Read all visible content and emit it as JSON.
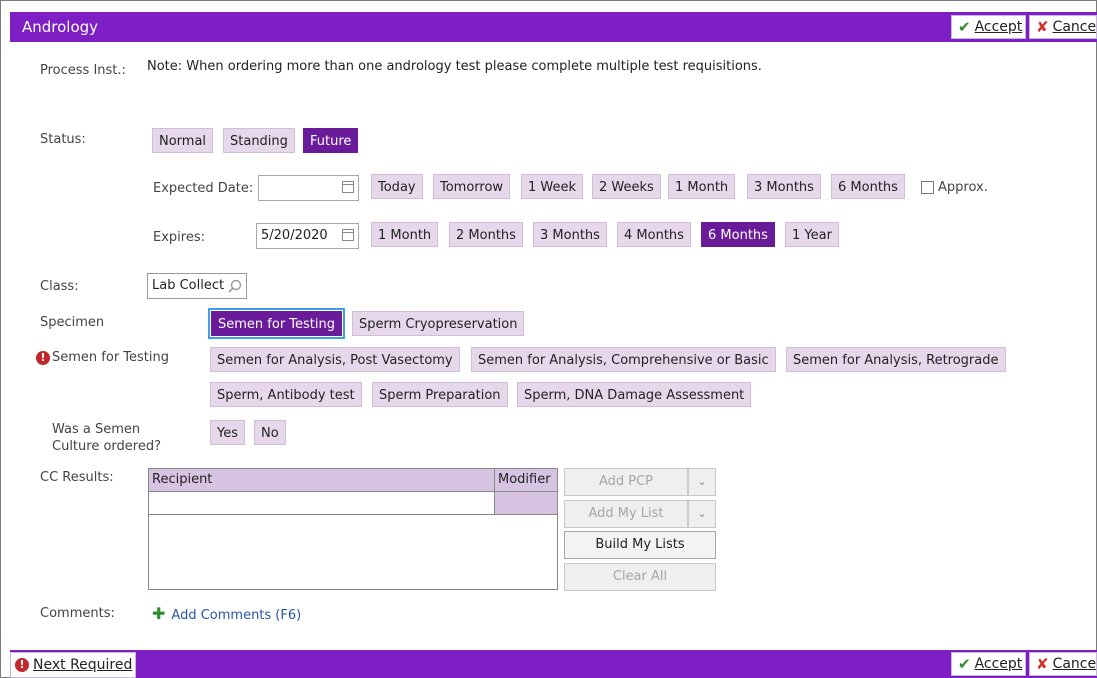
{
  "header": {
    "title": "Andrology",
    "accept": "Accept",
    "cancel": "Cancel"
  },
  "labels": {
    "process_inst": "Process Inst.:",
    "status": "Status:",
    "expected_date": "Expected Date:",
    "expires": "Expires:",
    "class": "Class:",
    "specimen": "Specimen",
    "semen_for_testing": "Semen for Testing",
    "culture_q": "Was a Semen Culture ordered?",
    "cc_results": "CC Results:",
    "comments": "Comments:"
  },
  "note": "Note: When ordering more than one andrology test please complete multiple test requisitions.",
  "status": {
    "options": [
      "Normal",
      "Standing",
      "Future"
    ],
    "selected": "Future"
  },
  "expected_date": {
    "value": "",
    "quick": [
      "Today",
      "Tomorrow",
      "1 Week",
      "2 Weeks",
      "1 Month",
      "3 Months",
      "6 Months"
    ],
    "approx": "Approx."
  },
  "expires": {
    "value": "5/20/2020",
    "options": [
      "1 Month",
      "2 Months",
      "3 Months",
      "4 Months",
      "6 Months",
      "1 Year"
    ],
    "selected": "6 Months"
  },
  "class": {
    "value": "Lab Collect"
  },
  "specimen": {
    "options": [
      "Semen for Testing",
      "Sperm Cryopreservation"
    ],
    "selected": "Semen for Testing"
  },
  "semen_tests": {
    "options": [
      "Semen for Analysis, Post Vasectomy",
      "Semen for Analysis, Comprehensive or Basic",
      "Semen for Analysis, Retrograde",
      "Sperm, Antibody test",
      "Sperm Preparation",
      "Sperm, DNA Damage Assessment"
    ]
  },
  "culture": {
    "options": [
      "Yes",
      "No"
    ]
  },
  "cc": {
    "columns": [
      "Recipient",
      "Modifier"
    ],
    "buttons": {
      "add_pcp": "Add PCP",
      "add_my_list": "Add My List",
      "build_my_lists": "Build My Lists",
      "clear_all": "Clear All"
    }
  },
  "comments": {
    "add": "Add Comments (F6)"
  },
  "footer": {
    "next_required": "Next Required",
    "accept": "Accept",
    "cancel": "Cancel"
  },
  "colors": {
    "accent": "#7d1fc4",
    "selected": "#6a1b9a",
    "pill": "#e6d8ea",
    "error": "#c0282d"
  }
}
